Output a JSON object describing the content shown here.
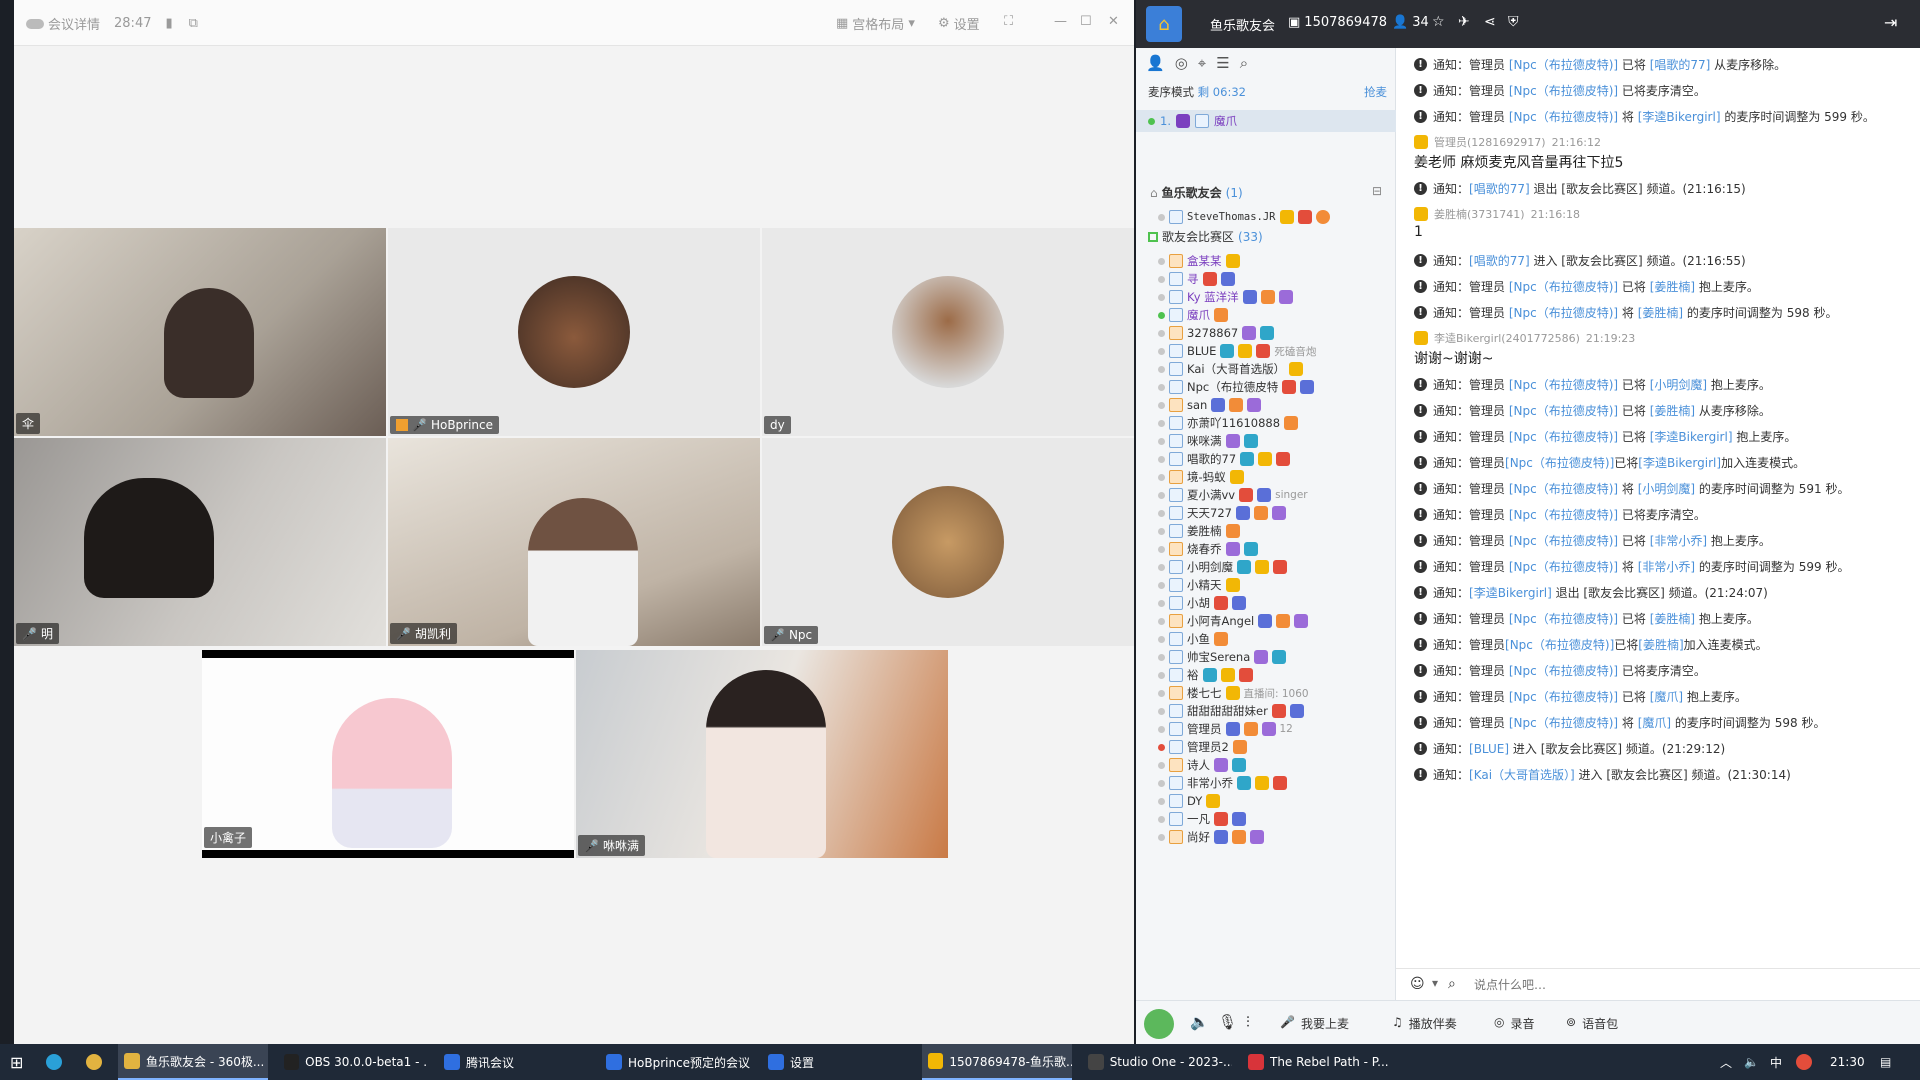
{
  "meeting": {
    "title": "会议详情",
    "timer": "28:47",
    "layout_label": "宫格布局",
    "settings_label": "设置",
    "tiles": [
      {
        "name": "伞"
      },
      {
        "name": "HoBprince"
      },
      {
        "name": "dy"
      },
      {
        "name": "明"
      },
      {
        "name": "胡凯利"
      },
      {
        "name": "Npc"
      },
      {
        "name": "小禽子"
      },
      {
        "name": "咻咻满"
      }
    ]
  },
  "app": {
    "room_name": "鱼乐歌友会",
    "room_id": "1507869478",
    "online_count": "34",
    "queue_mode": "麦序模式",
    "queue_remaining": "剩 06:32",
    "grab_label": "抢麦",
    "queue_item_num": "1.",
    "queue_item_name": "魔爪",
    "group_root": "鱼乐歌友会",
    "group_root_count": "(1)",
    "sub_channel": "歌友会比赛区",
    "sub_channel_count": "(33)",
    "input_placeholder": "说点什么吧…",
    "bottom": {
      "mic_label": "我要上麦",
      "music_label": "播放伴奏",
      "record_label": "录音",
      "voice_label": "语音包"
    }
  },
  "users": [
    {
      "name": "SteveThomas.JR",
      "extra": ""
    },
    {
      "name": "盒某某",
      "extra": ""
    },
    {
      "name": "寻",
      "extra": ""
    },
    {
      "name": "Ky 蓝洋洋",
      "extra": ""
    },
    {
      "name": "魔爪",
      "extra": ""
    },
    {
      "name": "3278867",
      "extra": ""
    },
    {
      "name": "BLUE",
      "extra": "死磕音炮"
    },
    {
      "name": "Kai（大哥首选版）",
      "extra": ""
    },
    {
      "name": "Npc（布拉德皮特",
      "extra": ""
    },
    {
      "name": "san",
      "extra": ""
    },
    {
      "name": "亦萧吖11610888",
      "extra": ""
    },
    {
      "name": "咪咪满",
      "extra": ""
    },
    {
      "name": "唱歌的77",
      "extra": ""
    },
    {
      "name": "境-蚂蚁",
      "extra": ""
    },
    {
      "name": "夏小满vv",
      "extra": "singer"
    },
    {
      "name": "天天727",
      "extra": ""
    },
    {
      "name": "姜胜楠",
      "extra": ""
    },
    {
      "name": "烧春乔",
      "extra": ""
    },
    {
      "name": "小明剑魔",
      "extra": ""
    },
    {
      "name": "小精天",
      "extra": ""
    },
    {
      "name": "小胡",
      "extra": ""
    },
    {
      "name": "小阿青Angel",
      "extra": ""
    },
    {
      "name": "小鱼",
      "extra": ""
    },
    {
      "name": "帅宝Serena",
      "extra": ""
    },
    {
      "name": "裕",
      "extra": ""
    },
    {
      "name": "楼七七",
      "extra": "直播间: 1060"
    },
    {
      "name": "甜甜甜甜甜妹er",
      "extra": ""
    },
    {
      "name": "管理员",
      "extra": "12"
    },
    {
      "name": "管理员2",
      "extra": ""
    },
    {
      "name": "诗人",
      "extra": ""
    },
    {
      "name": "非常小乔",
      "extra": ""
    },
    {
      "name": "DY",
      "extra": ""
    },
    {
      "name": "一凡",
      "extra": ""
    },
    {
      "name": "尚好",
      "extra": ""
    }
  ],
  "chat": [
    {
      "type": "notice",
      "prefix": "通知：管理员 ",
      "link1": "[Npc（布拉德皮特)]",
      "mid": " 已将 ",
      "link2": "[唱歌的77]",
      "tail": " 从麦序移除。"
    },
    {
      "type": "notice",
      "prefix": "通知：管理员 ",
      "link1": "[Npc（布拉德皮特)]",
      "mid": " 已将麦序清空。",
      "link2": "",
      "tail": ""
    },
    {
      "type": "notice",
      "prefix": "通知：管理员 ",
      "link1": "[Npc（布拉德皮特)]",
      "mid": " 将 ",
      "link2": "[李逵Bikergirl]",
      "tail": " 的麦序时间调整为 599 秒。"
    },
    {
      "type": "user",
      "who": "管理员(1281692917)",
      "time": "21:16:12",
      "text": "姜老师 麻烦麦克风音量再往下拉5"
    },
    {
      "type": "notice",
      "prefix": "通知：",
      "link1": "[唱歌的77]",
      "mid": " 退出 [歌友会比赛区] 频道。",
      "link2": "",
      "tail": "(21:16:15)"
    },
    {
      "type": "user",
      "who": "姜胜楠(3731741)",
      "time": "21:16:18",
      "text": "1"
    },
    {
      "type": "notice",
      "prefix": "通知：",
      "link1": "[唱歌的77]",
      "mid": " 进入 [歌友会比赛区] 频道。",
      "link2": "",
      "tail": "(21:16:55)"
    },
    {
      "type": "notice",
      "prefix": "通知：管理员 ",
      "link1": "[Npc（布拉德皮特)]",
      "mid": " 已将 ",
      "link2": "[姜胜楠]",
      "tail": " 抱上麦序。"
    },
    {
      "type": "notice",
      "prefix": "通知：管理员 ",
      "link1": "[Npc（布拉德皮特)]",
      "mid": " 将 ",
      "link2": "[姜胜楠]",
      "tail": " 的麦序时间调整为 598 秒。"
    },
    {
      "type": "user",
      "who": "李逵Bikergirl(2401772586)",
      "time": "21:19:23",
      "text": "谢谢~谢谢~"
    },
    {
      "type": "notice",
      "prefix": "通知：管理员 ",
      "link1": "[Npc（布拉德皮特)]",
      "mid": " 已将 ",
      "link2": "[小明剑魔]",
      "tail": " 抱上麦序。"
    },
    {
      "type": "notice",
      "prefix": "通知：管理员 ",
      "link1": "[Npc（布拉德皮特)]",
      "mid": " 已将 ",
      "link2": "[姜胜楠]",
      "tail": " 从麦序移除。"
    },
    {
      "type": "notice",
      "prefix": "通知：管理员 ",
      "link1": "[Npc（布拉德皮特)]",
      "mid": " 已将 ",
      "link2": "[李逵Bikergirl]",
      "tail": " 抱上麦序。"
    },
    {
      "type": "notice",
      "prefix": "通知：管理员",
      "link1": "[Npc（布拉德皮特)]",
      "mid": "已将",
      "link2": "[李逵Bikergirl]",
      "tail": "加入连麦模式。"
    },
    {
      "type": "notice",
      "prefix": "通知：管理员 ",
      "link1": "[Npc（布拉德皮特)]",
      "mid": " 将 ",
      "link2": "[小明剑魔]",
      "tail": " 的麦序时间调整为 591 秒。"
    },
    {
      "type": "notice",
      "prefix": "通知：管理员 ",
      "link1": "[Npc（布拉德皮特)]",
      "mid": " 已将麦序清空。",
      "link2": "",
      "tail": ""
    },
    {
      "type": "notice",
      "prefix": "通知：管理员 ",
      "link1": "[Npc（布拉德皮特)]",
      "mid": " 已将 ",
      "link2": "[非常小乔]",
      "tail": " 抱上麦序。"
    },
    {
      "type": "notice",
      "prefix": "通知：管理员 ",
      "link1": "[Npc（布拉德皮特)]",
      "mid": " 将 ",
      "link2": "[非常小乔]",
      "tail": " 的麦序时间调整为 599 秒。"
    },
    {
      "type": "notice",
      "prefix": "通知：",
      "link1": "[李逵Bikergirl]",
      "mid": " 退出 [歌友会比赛区] 频道。",
      "link2": "",
      "tail": "(21:24:07)"
    },
    {
      "type": "notice",
      "prefix": "通知：管理员 ",
      "link1": "[Npc（布拉德皮特)]",
      "mid": " 已将 ",
      "link2": "[姜胜楠]",
      "tail": " 抱上麦序。"
    },
    {
      "type": "notice",
      "prefix": "通知：管理员",
      "link1": "[Npc（布拉德皮特)]",
      "mid": "已将",
      "link2": "[姜胜楠]",
      "tail": "加入连麦模式。"
    },
    {
      "type": "notice",
      "prefix": "通知：管理员 ",
      "link1": "[Npc（布拉德皮特)]",
      "mid": " 已将麦序清空。",
      "link2": "",
      "tail": ""
    },
    {
      "type": "notice",
      "prefix": "通知：管理员 ",
      "link1": "[Npc（布拉德皮特)]",
      "mid": " 已将 ",
      "link2": "[魔爪]",
      "tail": " 抱上麦序。"
    },
    {
      "type": "notice",
      "prefix": "通知：管理员 ",
      "link1": "[Npc（布拉德皮特)]",
      "mid": " 将 ",
      "link2": "[魔爪]",
      "tail": " 的麦序时间调整为 598 秒。"
    },
    {
      "type": "notice",
      "prefix": "通知：",
      "link1": "[BLUE]",
      "mid": " 进入 [歌友会比赛区] 频道。",
      "link2": "",
      "tail": "(21:29:12)"
    },
    {
      "type": "notice",
      "prefix": "通知：",
      "link1": "[Kai（大哥首选版）]",
      "mid": " 进入 [歌友会比赛区] 频道。",
      "link2": "",
      "tail": "(21:30:14)"
    }
  ],
  "taskbar": {
    "items": [
      "鱼乐歌友会 - 360极...",
      "OBS 30.0.0-beta1 - ...",
      "腾讯会议",
      "HoBprince预定的会议",
      "设置",
      "1507869478-鱼乐歌...",
      "Studio One - 2023-...",
      "The Rebel Path - P..."
    ],
    "ime": "中",
    "clock": "21:30"
  },
  "colors": {
    "accent": "#4a90d9",
    "title_bg": "#2b2d33",
    "taskbar_bg": "#1f2937",
    "queue_name": "#7b3fbf"
  }
}
